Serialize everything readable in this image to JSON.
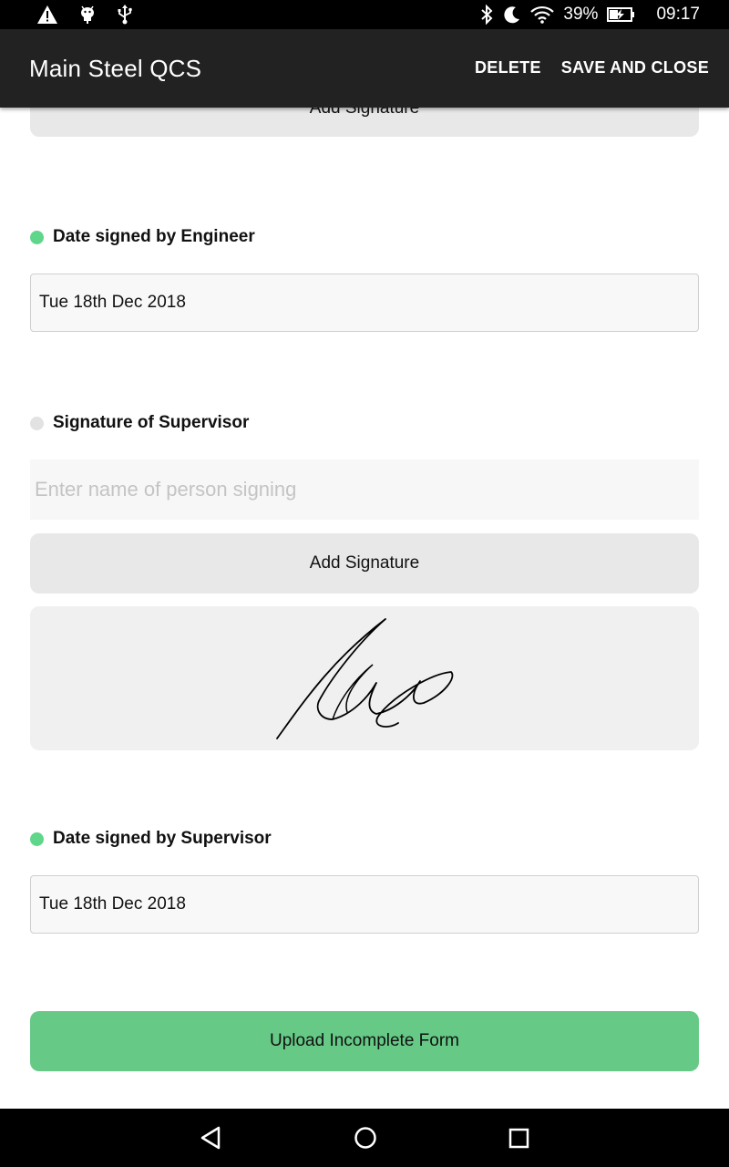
{
  "status_bar": {
    "battery": "39%",
    "time": "09:17"
  },
  "app_bar": {
    "title": "Main Steel QCS",
    "delete_label": "DELETE",
    "save_label": "SAVE AND CLOSE"
  },
  "form": {
    "top_add_signature_label": "Add Signature",
    "engineer_date": {
      "label": "Date signed by Engineer",
      "value": "Tue 18th Dec 2018"
    },
    "supervisor_signature": {
      "label": "Signature of Supervisor",
      "name_value": "",
      "name_placeholder": "Enter name of person signing",
      "add_signature_label": "Add Signature"
    },
    "supervisor_date": {
      "label": "Date signed by Supervisor",
      "value": "Tue 18th Dec 2018"
    },
    "upload_label": "Upload Incomplete Form"
  },
  "colors": {
    "app_bar": "#222222",
    "status_complete": "#5fd68a",
    "status_incomplete": "#e2e2e2",
    "upload_button": "#66c986",
    "secondary_button": "#e8e8e8"
  }
}
